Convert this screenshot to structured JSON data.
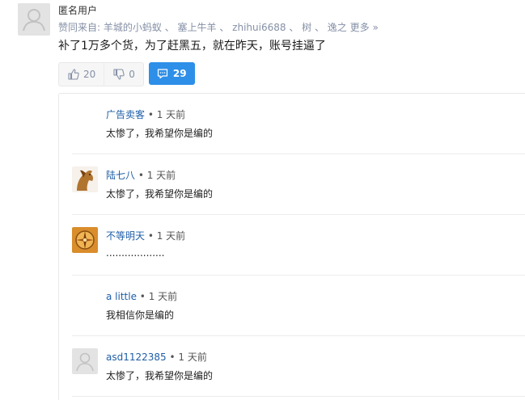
{
  "answer": {
    "author": "匿名用户",
    "upvote_prefix": "赞同来自: ",
    "upvoters": [
      "羊城的小蚂蚁",
      "塞上牛羊",
      "zhihui6688",
      "树",
      "逸之"
    ],
    "upvote_separator": " 、 ",
    "more_label": "更多 »",
    "content": "补了1万多个货，为了赶黑五，就在昨天，账号挂逼了",
    "upvote_count": "20",
    "downvote_count": "0",
    "comment_count": "29"
  },
  "comments": [
    {
      "user": "广告卖客",
      "time": "• 1 天前",
      "text": "太惨了，我希望你是编的",
      "avatar": "none"
    },
    {
      "user": "陆七八",
      "time": "• 1 天前",
      "text": "太惨了，我希望你是编的",
      "avatar": "horse"
    },
    {
      "user": "不等明天",
      "time": "• 1 天前",
      "text": "...................",
      "avatar": "compass"
    },
    {
      "user": "a little",
      "time": "• 1 天前",
      "text": "我相信你是编的",
      "avatar": "none"
    },
    {
      "user": "asd1122385",
      "time": "• 1 天前",
      "text": "太惨了，我希望你是编的",
      "avatar": "default"
    }
  ],
  "colors": {
    "accent": "#2d8fe8",
    "link": "#1f5ea8",
    "muted": "#8590a6"
  }
}
